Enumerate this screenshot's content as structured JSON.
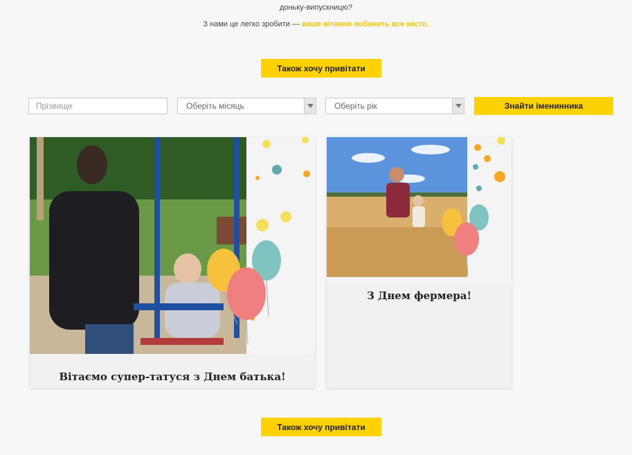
{
  "intro": {
    "line_cut": "… … … … … … … …",
    "line1": "доньку-випускницю?",
    "line2_prefix": "З нами це легко зробити — ",
    "line2_highlight": "ваше вітання побачить все місто."
  },
  "cta": {
    "top_label": "Також хочу привітати",
    "bottom_label": "Також хочу привітати"
  },
  "filters": {
    "surname_placeholder": "Прізвище",
    "month_value": "Оберіть місяць",
    "year_value": "Оберіть рік",
    "find_label": "Знайти іменинника"
  },
  "cards": [
    {
      "caption": "Вітаємо супер-татуся з Днем батька!",
      "photo_desc_icon": "father-son-swing-photo"
    },
    {
      "caption": "З Днем фермера!",
      "photo_desc_icon": "farmer-wheat-field-photo"
    }
  ],
  "colors": {
    "accent": "#ffd200",
    "highlight": "#f5c400",
    "background": "#f7f7f7"
  }
}
